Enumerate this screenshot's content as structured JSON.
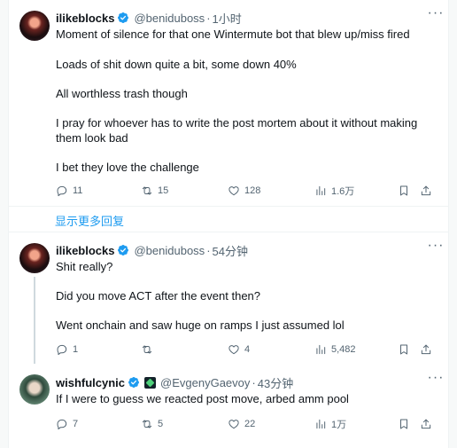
{
  "tweets": [
    {
      "name": "ilikeblocks",
      "handle": "@beniduboss",
      "separator": "·",
      "time": "1小时",
      "paragraphs": [
        "Moment of silence for that one Wintermute bot that blew up/miss fired",
        "Loads of shit down quite a bit, some down 40%",
        "All worthless trash though",
        "I pray for whoever has to write the post mortem about it without making them look bad",
        "I bet they love the challenge"
      ],
      "replies": "11",
      "retweets": "15",
      "likes": "128",
      "views": "1.6万"
    },
    {
      "name": "ilikeblocks",
      "handle": "@beniduboss",
      "separator": "·",
      "time": "54分钟",
      "paragraphs": [
        "Shit really?",
        "Did you move ACT after the event then?",
        "Went onchain and saw huge on ramps I just assumed lol"
      ],
      "replies": "1",
      "retweets": "",
      "likes": "4",
      "views": "5,482"
    },
    {
      "name": "wishfulcynic",
      "handle": "@EvgenyGaevoy",
      "separator": "·",
      "time": "43分钟",
      "paragraphs": [
        "If I were to guess we reacted post move, arbed amm pool"
      ],
      "replies": "7",
      "retweets": "5",
      "likes": "22",
      "views": "1万"
    }
  ],
  "show_more": "显示更多回复",
  "colors": {
    "accent": "#1d9bf0",
    "secondary_text": "#536471",
    "text": "#0f1419"
  },
  "icons": [
    "verified-badge-icon",
    "more-icon",
    "reply-icon",
    "retweet-icon",
    "like-icon",
    "views-icon",
    "bookmark-icon",
    "share-icon",
    "affiliate-logo-icon"
  ]
}
